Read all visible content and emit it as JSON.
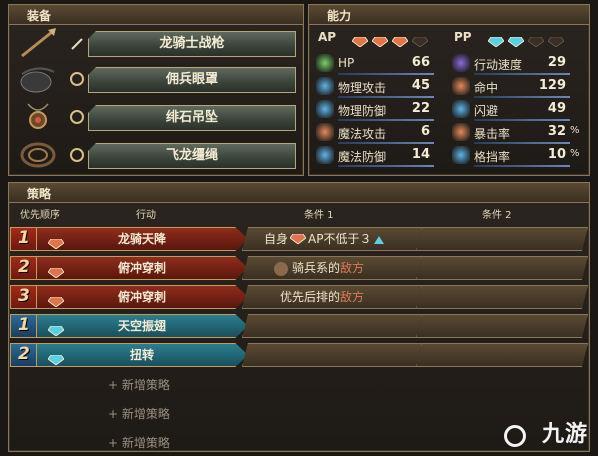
{
  "equipment": {
    "title": "装备",
    "items": [
      {
        "name": "龙骑士战枪",
        "icon": "spear-icon"
      },
      {
        "name": "佣兵眼罩",
        "icon": "eyepatch-icon"
      },
      {
        "name": "绯石吊坠",
        "icon": "pendant-icon"
      },
      {
        "name": "飞龙缰绳",
        "icon": "reins-icon"
      }
    ]
  },
  "abilities": {
    "title": "能力",
    "ap_label": "AP",
    "pp_label": "PP",
    "ap_gems_filled": 3,
    "ap_gems_total": 4,
    "pp_gems_filled": 2,
    "pp_gems_total": 4,
    "stats_left": [
      {
        "label": "HP",
        "value": "66",
        "icon": "heart-icon",
        "color": "#7bd06a"
      },
      {
        "label": "物理攻击",
        "value": "45",
        "icon": "sword-icon",
        "color": "#5fb3e6"
      },
      {
        "label": "物理防御",
        "value": "22",
        "icon": "armor-icon",
        "color": "#5fb3e6"
      },
      {
        "label": "魔法攻击",
        "value": "6",
        "icon": "staff-icon",
        "color": "#e58a5a"
      },
      {
        "label": "魔法防御",
        "value": "14",
        "icon": "shield-icon",
        "color": "#5fb3e6"
      }
    ],
    "stats_right": [
      {
        "label": "行动速度",
        "value": "29",
        "suffix": "",
        "icon": "speed-icon",
        "color": "#8c6bd6"
      },
      {
        "label": "命中",
        "value": "129",
        "suffix": "",
        "icon": "target-icon",
        "color": "#e58a5a"
      },
      {
        "label": "闪避",
        "value": "49",
        "suffix": "",
        "icon": "evade-icon",
        "color": "#5fb3e6"
      },
      {
        "label": "暴击率",
        "value": "32",
        "suffix": "%",
        "icon": "crit-icon",
        "color": "#e58a5a"
      },
      {
        "label": "格挡率",
        "value": "10",
        "suffix": "%",
        "icon": "block-icon",
        "color": "#5fb3e6"
      }
    ]
  },
  "strategy": {
    "title": "策略",
    "col_priority": "优先顺序",
    "col_action": "行动",
    "col_cond1": "条件 1",
    "col_cond2": "条件 2",
    "rows": [
      {
        "rank": "1",
        "type": "red",
        "action": "龙骑天降",
        "cond1_prefix": "自身",
        "cond1_main": "AP不低于３",
        "cond1_suffix": "",
        "has_up": true
      },
      {
        "rank": "2",
        "type": "red",
        "action": "俯冲穿刺",
        "cond1_prefix": "",
        "cond1_main": "骑兵系的",
        "cond1_suffix": "敌方",
        "has_up": false
      },
      {
        "rank": "3",
        "type": "red",
        "action": "俯冲穿刺",
        "cond1_prefix": "",
        "cond1_main": "优先后排的",
        "cond1_suffix": "敌方",
        "has_up": false
      },
      {
        "rank": "1",
        "type": "blue",
        "action": "天空振翅",
        "cond1_prefix": "",
        "cond1_main": "",
        "cond1_suffix": "",
        "has_up": false
      },
      {
        "rank": "2",
        "type": "blue",
        "action": "扭转",
        "cond1_prefix": "",
        "cond1_main": "",
        "cond1_suffix": "",
        "has_up": false
      }
    ],
    "add_label": "新增策略",
    "add_count": 3
  },
  "watermark": "九游"
}
